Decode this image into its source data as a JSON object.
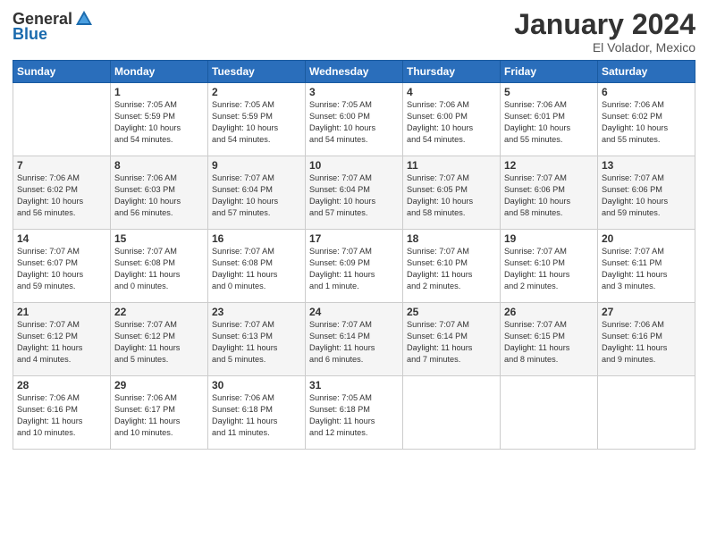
{
  "header": {
    "logo_general": "General",
    "logo_blue": "Blue",
    "month_year": "January 2024",
    "location": "El Volador, Mexico"
  },
  "days_of_week": [
    "Sunday",
    "Monday",
    "Tuesday",
    "Wednesday",
    "Thursday",
    "Friday",
    "Saturday"
  ],
  "weeks": [
    [
      {
        "num": "",
        "info": ""
      },
      {
        "num": "1",
        "info": "Sunrise: 7:05 AM\nSunset: 5:59 PM\nDaylight: 10 hours\nand 54 minutes."
      },
      {
        "num": "2",
        "info": "Sunrise: 7:05 AM\nSunset: 5:59 PM\nDaylight: 10 hours\nand 54 minutes."
      },
      {
        "num": "3",
        "info": "Sunrise: 7:05 AM\nSunset: 6:00 PM\nDaylight: 10 hours\nand 54 minutes."
      },
      {
        "num": "4",
        "info": "Sunrise: 7:06 AM\nSunset: 6:00 PM\nDaylight: 10 hours\nand 54 minutes."
      },
      {
        "num": "5",
        "info": "Sunrise: 7:06 AM\nSunset: 6:01 PM\nDaylight: 10 hours\nand 55 minutes."
      },
      {
        "num": "6",
        "info": "Sunrise: 7:06 AM\nSunset: 6:02 PM\nDaylight: 10 hours\nand 55 minutes."
      }
    ],
    [
      {
        "num": "7",
        "info": "Sunrise: 7:06 AM\nSunset: 6:02 PM\nDaylight: 10 hours\nand 56 minutes."
      },
      {
        "num": "8",
        "info": "Sunrise: 7:06 AM\nSunset: 6:03 PM\nDaylight: 10 hours\nand 56 minutes."
      },
      {
        "num": "9",
        "info": "Sunrise: 7:07 AM\nSunset: 6:04 PM\nDaylight: 10 hours\nand 57 minutes."
      },
      {
        "num": "10",
        "info": "Sunrise: 7:07 AM\nSunset: 6:04 PM\nDaylight: 10 hours\nand 57 minutes."
      },
      {
        "num": "11",
        "info": "Sunrise: 7:07 AM\nSunset: 6:05 PM\nDaylight: 10 hours\nand 58 minutes."
      },
      {
        "num": "12",
        "info": "Sunrise: 7:07 AM\nSunset: 6:06 PM\nDaylight: 10 hours\nand 58 minutes."
      },
      {
        "num": "13",
        "info": "Sunrise: 7:07 AM\nSunset: 6:06 PM\nDaylight: 10 hours\nand 59 minutes."
      }
    ],
    [
      {
        "num": "14",
        "info": "Sunrise: 7:07 AM\nSunset: 6:07 PM\nDaylight: 10 hours\nand 59 minutes."
      },
      {
        "num": "15",
        "info": "Sunrise: 7:07 AM\nSunset: 6:08 PM\nDaylight: 11 hours\nand 0 minutes."
      },
      {
        "num": "16",
        "info": "Sunrise: 7:07 AM\nSunset: 6:08 PM\nDaylight: 11 hours\nand 0 minutes."
      },
      {
        "num": "17",
        "info": "Sunrise: 7:07 AM\nSunset: 6:09 PM\nDaylight: 11 hours\nand 1 minute."
      },
      {
        "num": "18",
        "info": "Sunrise: 7:07 AM\nSunset: 6:10 PM\nDaylight: 11 hours\nand 2 minutes."
      },
      {
        "num": "19",
        "info": "Sunrise: 7:07 AM\nSunset: 6:10 PM\nDaylight: 11 hours\nand 2 minutes."
      },
      {
        "num": "20",
        "info": "Sunrise: 7:07 AM\nSunset: 6:11 PM\nDaylight: 11 hours\nand 3 minutes."
      }
    ],
    [
      {
        "num": "21",
        "info": "Sunrise: 7:07 AM\nSunset: 6:12 PM\nDaylight: 11 hours\nand 4 minutes."
      },
      {
        "num": "22",
        "info": "Sunrise: 7:07 AM\nSunset: 6:12 PM\nDaylight: 11 hours\nand 5 minutes."
      },
      {
        "num": "23",
        "info": "Sunrise: 7:07 AM\nSunset: 6:13 PM\nDaylight: 11 hours\nand 5 minutes."
      },
      {
        "num": "24",
        "info": "Sunrise: 7:07 AM\nSunset: 6:14 PM\nDaylight: 11 hours\nand 6 minutes."
      },
      {
        "num": "25",
        "info": "Sunrise: 7:07 AM\nSunset: 6:14 PM\nDaylight: 11 hours\nand 7 minutes."
      },
      {
        "num": "26",
        "info": "Sunrise: 7:07 AM\nSunset: 6:15 PM\nDaylight: 11 hours\nand 8 minutes."
      },
      {
        "num": "27",
        "info": "Sunrise: 7:06 AM\nSunset: 6:16 PM\nDaylight: 11 hours\nand 9 minutes."
      }
    ],
    [
      {
        "num": "28",
        "info": "Sunrise: 7:06 AM\nSunset: 6:16 PM\nDaylight: 11 hours\nand 10 minutes."
      },
      {
        "num": "29",
        "info": "Sunrise: 7:06 AM\nSunset: 6:17 PM\nDaylight: 11 hours\nand 10 minutes."
      },
      {
        "num": "30",
        "info": "Sunrise: 7:06 AM\nSunset: 6:18 PM\nDaylight: 11 hours\nand 11 minutes."
      },
      {
        "num": "31",
        "info": "Sunrise: 7:05 AM\nSunset: 6:18 PM\nDaylight: 11 hours\nand 12 minutes."
      },
      {
        "num": "",
        "info": ""
      },
      {
        "num": "",
        "info": ""
      },
      {
        "num": "",
        "info": ""
      }
    ]
  ]
}
